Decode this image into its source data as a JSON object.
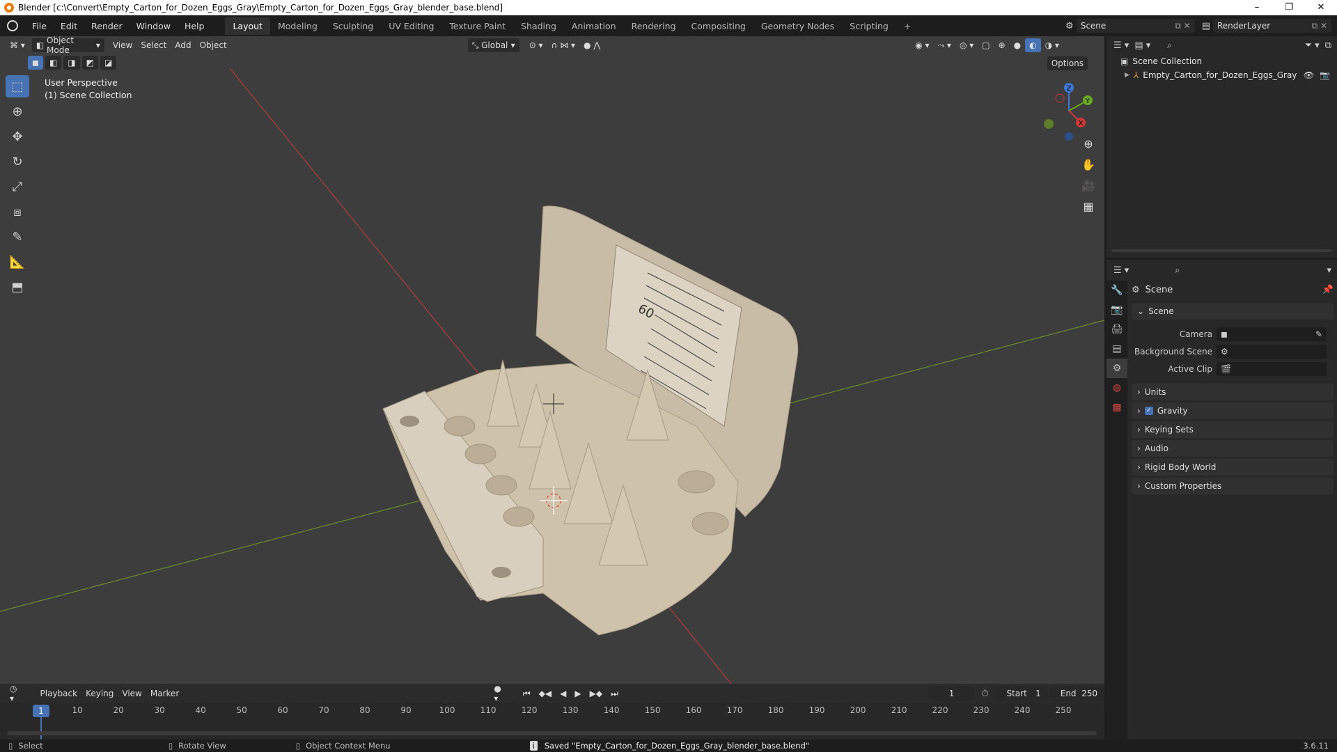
{
  "window": {
    "title": "Blender [c:\\Convert\\Empty_Carton_for_Dozen_Eggs_Gray\\Empty_Carton_for_Dozen_Eggs_Gray_blender_base.blend]",
    "minimize": "–",
    "maximize": "❐",
    "close": "✕"
  },
  "menu": {
    "items": [
      "File",
      "Edit",
      "Render",
      "Window",
      "Help"
    ]
  },
  "workspaces": [
    "Layout",
    "Modeling",
    "Sculpting",
    "UV Editing",
    "Texture Paint",
    "Shading",
    "Animation",
    "Rendering",
    "Compositing",
    "Geometry Nodes",
    "Scripting"
  ],
  "workspace_add": "+",
  "topright": {
    "scene": "Scene",
    "view_layer": "RenderLayer"
  },
  "viewport": {
    "mode": "Object Mode",
    "menus": [
      "View",
      "Select",
      "Add",
      "Object"
    ],
    "orientation": "Global",
    "options": "Options",
    "perspective": "User Perspective",
    "collection": "(1) Scene Collection",
    "gizmo": {
      "x": "X",
      "y": "Y",
      "z": "Z"
    }
  },
  "outliner": {
    "root": "Scene Collection",
    "object": "Empty_Carton_for_Dozen_Eggs_Gray"
  },
  "properties": {
    "header": "Scene",
    "panel": "Scene",
    "fields": [
      {
        "label": "Camera"
      },
      {
        "label": "Background Scene"
      },
      {
        "label": "Active Clip"
      }
    ],
    "sections": [
      "Units",
      "Gravity",
      "Keying Sets",
      "Audio",
      "Rigid Body World",
      "Custom Properties"
    ],
    "gravity_checked": true
  },
  "timeline": {
    "menus": [
      "Playback",
      "Keying",
      "View",
      "Marker"
    ],
    "current_frame": "1",
    "start_label": "Start",
    "start": "1",
    "end_label": "End",
    "end": "250",
    "ticks": [
      "1",
      "10",
      "20",
      "30",
      "40",
      "50",
      "60",
      "70",
      "80",
      "90",
      "100",
      "110",
      "120",
      "130",
      "140",
      "150",
      "160",
      "170",
      "180",
      "190",
      "200",
      "210",
      "220",
      "230",
      "240",
      "250"
    ]
  },
  "status": {
    "select": "Select",
    "rotate": "Rotate View",
    "context": "Object Context Menu",
    "message": "Saved \"Empty_Carton_for_Dozen_Eggs_Gray_blender_base.blend\"",
    "version": "3.6.11"
  },
  "label": {
    "sticker_number": "60"
  }
}
